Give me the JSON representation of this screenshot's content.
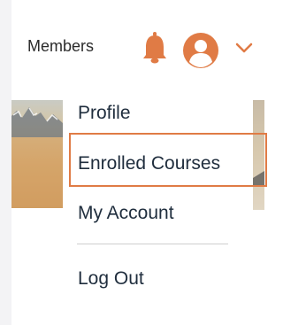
{
  "header": {
    "members_label": "Members",
    "bell_icon": "bell-icon",
    "avatar_icon": "user-avatar-icon",
    "chevron_icon": "chevron-down-icon",
    "accent_color": "#e07b45"
  },
  "menu": {
    "items": [
      {
        "label": "Profile"
      },
      {
        "label": "Enrolled Courses",
        "highlighted": true
      },
      {
        "label": "My Account"
      },
      {
        "label": "Log Out"
      }
    ],
    "highlight_color": "#e07b45"
  }
}
